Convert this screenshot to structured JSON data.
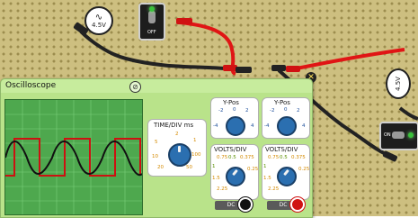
{
  "supply_ac": {
    "label": "4.5V"
  },
  "supply_dc": {
    "label": "4.5V"
  },
  "switch1": {
    "label": "OFF"
  },
  "switch2": {
    "label": "ON"
  },
  "scope": {
    "title": "Oscilloscope",
    "timebase": {
      "label": "TIME/DIV ms",
      "ticks": [
        "5",
        "2",
        "1",
        "10",
        "100",
        "20",
        "50"
      ]
    },
    "ypos_left": {
      "label": "Y-Pos",
      "ticks": [
        "-2",
        "0",
        "2",
        "-4",
        "4"
      ]
    },
    "ypos_right": {
      "label": "Y-Pos",
      "ticks": [
        "-2",
        "0",
        "2",
        "-4",
        "4"
      ]
    },
    "volts_left": {
      "label": "VOLTS/DIV",
      "ticks": [
        "0.5",
        "1",
        "0.75",
        "0.375",
        "1.5",
        "0.25",
        "2.25"
      ]
    },
    "volts_right": {
      "label": "VOLTS/DIV",
      "ticks": [
        "0.5",
        "1",
        "0.75",
        "0.375",
        "1.5",
        "0.25",
        "2.25"
      ]
    },
    "coupling_left": "DC",
    "coupling_right": "DC"
  },
  "colors": {
    "trace1": "#111111",
    "trace2": "#cc1111",
    "screen": "#4ea84e",
    "board": "#cdbf80"
  }
}
